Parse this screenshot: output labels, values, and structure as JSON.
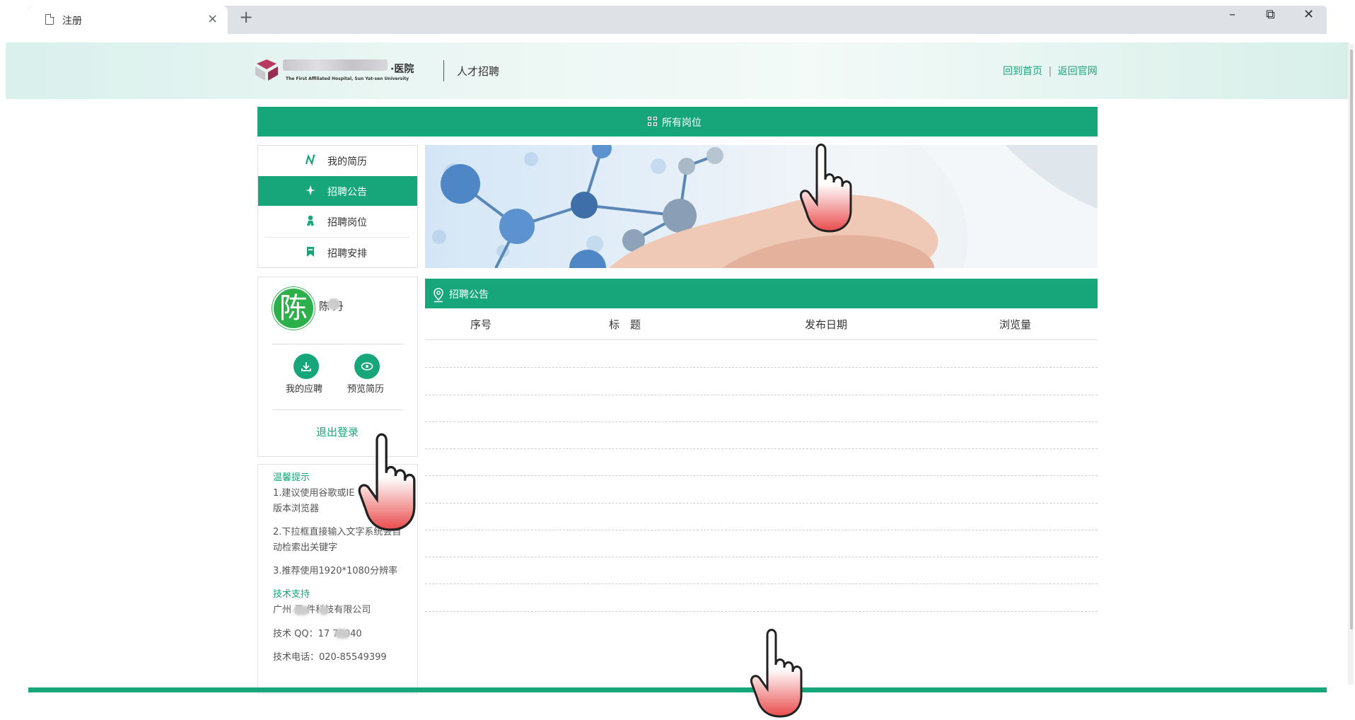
{
  "browser": {
    "tab_title": "注册",
    "tab_close": "×",
    "new_tab": "+",
    "minimize": "–",
    "restore": "⧉",
    "close": "✕"
  },
  "header": {
    "hospital_suffix": "·医院",
    "hospital_en": "The First Affiliated Hospital, Sun Yat-sen University",
    "title": "人才招聘",
    "link_home": "回到首页",
    "link_sep": "|",
    "link_official": "返回官网"
  },
  "all_positions": {
    "label": "所有岗位",
    "icon": "grid-icon"
  },
  "nav": {
    "items": [
      {
        "label": "我的简历",
        "icon": "resume-icon",
        "active": false
      },
      {
        "label": "招聘公告",
        "icon": "star-icon",
        "active": true
      },
      {
        "label": "招聘岗位",
        "icon": "person-icon",
        "active": false
      },
      {
        "label": "招聘安排",
        "icon": "bookmark-icon",
        "active": false
      }
    ]
  },
  "user": {
    "avatar_char": "陈",
    "name": "陈  丹",
    "my_applications": "我的应聘",
    "preview_resume": "预览简历",
    "logout": "退出登录"
  },
  "tips": {
    "title": "温馨提示",
    "line1a": "1.建议使用谷歌或IE",
    "line1b": "版本浏览器",
    "line2a": "2.下拉框直接输入文字系统会自",
    "line2b": "动检索出关键字",
    "line3": "3.推荐使用1920*1080分辨率",
    "support_title": "技术支持",
    "company": "广州  录  件科技有限公司",
    "qq": "技术 QQ：17   73040",
    "phone": "技术电话：020-85549399"
  },
  "announcement": {
    "title": "招聘公告",
    "columns": [
      "序号",
      "标　题",
      "发布日期",
      "浏览量"
    ],
    "rows": []
  },
  "colors": {
    "accent": "#17a67a",
    "avatar": "#2bb04a"
  }
}
